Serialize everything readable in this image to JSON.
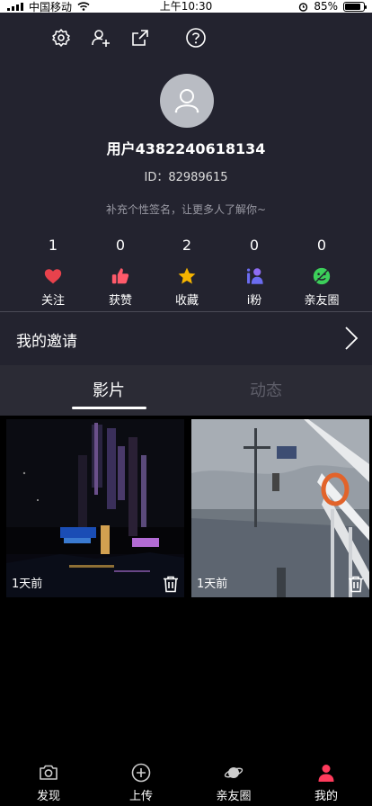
{
  "status_bar": {
    "carrier": "中国移动",
    "time": "上午10:30",
    "battery": "85%",
    "battery_level": 0.85
  },
  "profile": {
    "username": "用户4382240618134",
    "id_text": "ID：82989615",
    "signature": "补充个性签名，让更多人了解你~",
    "top_icons": [
      "gear-icon",
      "add-user-icon",
      "share-icon",
      "help-icon"
    ]
  },
  "stats": [
    {
      "count": "1",
      "label": "关注",
      "icon": "heart-icon",
      "color": "#e8424c"
    },
    {
      "count": "0",
      "label": "获赞",
      "icon": "thumbs-up-icon",
      "color": "#ff5a6a"
    },
    {
      "count": "2",
      "label": "收藏",
      "icon": "star-icon",
      "color": "#f5b400"
    },
    {
      "count": "0",
      "label": "i粉",
      "icon": "fans-icon",
      "color": "#6b6cf0"
    },
    {
      "count": "0",
      "label": "亲友圈",
      "icon": "friends-circle-icon",
      "color": "#3ccf5a"
    }
  ],
  "invite": {
    "label": "我的邀请"
  },
  "tabs": [
    {
      "label": "影片",
      "active": true
    },
    {
      "label": "动态",
      "active": false
    }
  ],
  "videos": [
    {
      "time": "1天前",
      "scene": "night-city-skyline"
    },
    {
      "time": "1天前",
      "scene": "ship-deck-sea"
    }
  ],
  "bottom_nav": [
    {
      "label": "发现",
      "icon": "camera-icon",
      "active": false
    },
    {
      "label": "上传",
      "icon": "upload-plus-icon",
      "active": false
    },
    {
      "label": "亲友圈",
      "icon": "planet-icon",
      "active": false
    },
    {
      "label": "我的",
      "icon": "profile-icon",
      "active": true
    }
  ],
  "colors": {
    "profile_bg": "#23232f",
    "tabs_bg": "#2b2b35",
    "active_nav": "#ff3b5c"
  }
}
